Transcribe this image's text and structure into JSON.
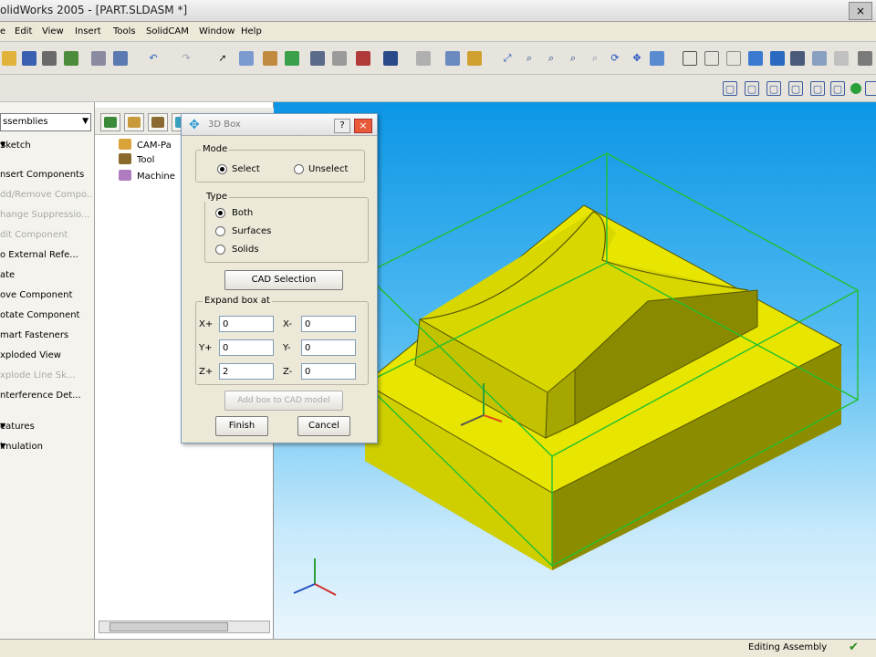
{
  "window": {
    "title": "olidWorks 2005 - [PART.SLDASM *]",
    "close_glyph": "×"
  },
  "menu": [
    "e",
    "Edit",
    "View",
    "Insert",
    "Tools",
    "SolidCAM",
    "Window",
    "Help"
  ],
  "command_manager": {
    "combo": "ssemblies",
    "items": [
      {
        "label": "Sketch",
        "disabled": false,
        "arrow": true
      },
      {
        "label": "nsert Components",
        "disabled": false,
        "arrow": false
      },
      {
        "label": "dd/Remove Compo...",
        "disabled": true,
        "arrow": false
      },
      {
        "label": "hange Suppressio...",
        "disabled": true,
        "arrow": false
      },
      {
        "label": "dit Component",
        "disabled": true,
        "arrow": false
      },
      {
        "label": "o External Refe...",
        "disabled": false,
        "arrow": false
      },
      {
        "label": "ate",
        "disabled": false,
        "arrow": false
      },
      {
        "label": "ove Component",
        "disabled": false,
        "arrow": false
      },
      {
        "label": "otate Component",
        "disabled": false,
        "arrow": false
      },
      {
        "label": "mart Fasteners",
        "disabled": false,
        "arrow": false
      },
      {
        "label": "xploded View",
        "disabled": false,
        "arrow": false
      },
      {
        "label": "xplode Line Sk...",
        "disabled": true,
        "arrow": false
      },
      {
        "label": "nterference Det...",
        "disabled": false,
        "arrow": false
      },
      {
        "label": "eatures",
        "disabled": false,
        "arrow": true
      },
      {
        "label": "imulation",
        "disabled": false,
        "arrow": true
      }
    ]
  },
  "feature_tree": [
    {
      "label": "CAM-Pa",
      "color": "#d9a33a"
    },
    {
      "label": "Tool",
      "color": "#8a6a2a"
    },
    {
      "label": "Machine",
      "color": "#b07cc0"
    }
  ],
  "dialog": {
    "title": "3D Box",
    "help_glyph": "?",
    "close_glyph": "×",
    "mode": {
      "label": "Mode",
      "select": "Select",
      "unselect": "Unselect",
      "selected": "select"
    },
    "type": {
      "label": "Type",
      "both": "Both",
      "surfaces": "Surfaces",
      "solids": "Solids",
      "selected": "both"
    },
    "cad_selection": "CAD Selection",
    "expand": {
      "label": "Expand box at",
      "x_plus": {
        "label": "X+",
        "value": "0"
      },
      "x_minus": {
        "label": "X-",
        "value": "0"
      },
      "y_plus": {
        "label": "Y+",
        "value": "0"
      },
      "y_minus": {
        "label": "Y-",
        "value": "0"
      },
      "z_plus": {
        "label": "Z+",
        "value": "2"
      },
      "z_minus": {
        "label": "Z-",
        "value": "0"
      }
    },
    "add_box": "Add box to CAD model",
    "finish": "Finish",
    "cancel": "Cancel"
  },
  "status": {
    "text": "Editing Assembly",
    "check_glyph": "✔"
  },
  "colors": {
    "part_yellow": "#e8e600",
    "wire_green": "#22c030",
    "bg_top": "#0c96e6"
  }
}
